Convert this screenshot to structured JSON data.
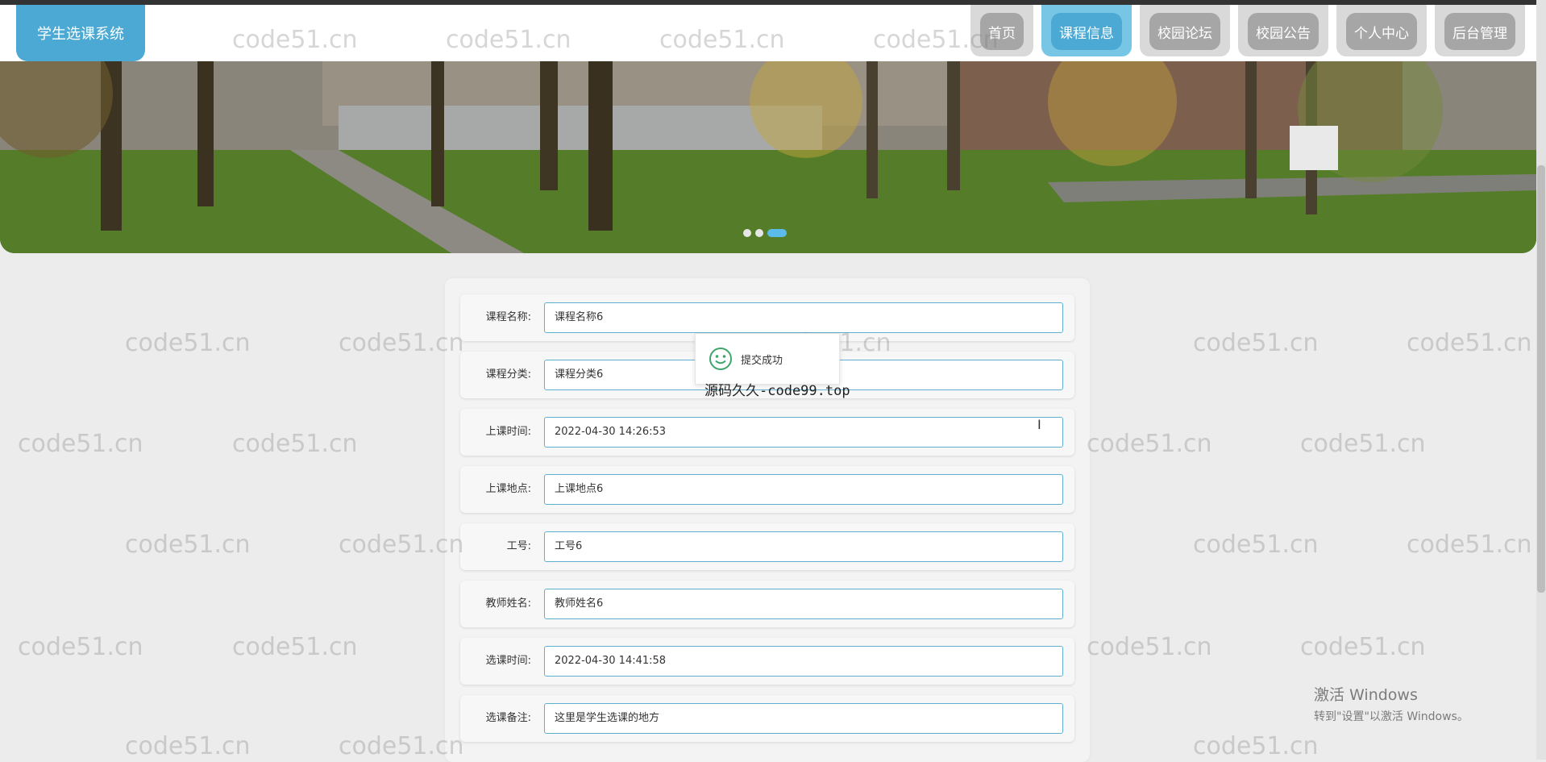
{
  "app": {
    "logo_text": "学生选课系统"
  },
  "nav": [
    {
      "label": "首页",
      "active": false
    },
    {
      "label": "课程信息",
      "active": true
    },
    {
      "label": "校园论坛",
      "active": false
    },
    {
      "label": "校园公告",
      "active": false
    },
    {
      "label": "个人中心",
      "active": false
    },
    {
      "label": "后台管理",
      "active": false
    }
  ],
  "banner": {
    "slides": 3,
    "active_index": 2
  },
  "form": {
    "fields": [
      {
        "label": "课程名称:",
        "value": "课程名称6"
      },
      {
        "label": "课程分类:",
        "value": "课程分类6"
      },
      {
        "label": "上课时间:",
        "value": "2022-04-30 14:26:53"
      },
      {
        "label": "上课地点:",
        "value": "上课地点6"
      },
      {
        "label": "工号:",
        "value": "工号6"
      },
      {
        "label": "教师姓名:",
        "value": "教师姓名6"
      },
      {
        "label": "选课时间:",
        "value": "2022-04-30 14:41:58"
      },
      {
        "label": "选课备注:",
        "value": "这里是学生选课的地方"
      }
    ]
  },
  "toast": {
    "message": "提交成功",
    "overlay_text": "源码久久-code99.top",
    "icon": "smile-icon"
  },
  "watermark_text": "code51.cn",
  "windows_activation": {
    "title": "激活 Windows",
    "subtitle": "转到\"设置\"以激活 Windows。"
  },
  "colors": {
    "accent": "#4ba9d3",
    "nav_inactive": "#a6a6a6",
    "input_border": "#5fb0d0"
  }
}
